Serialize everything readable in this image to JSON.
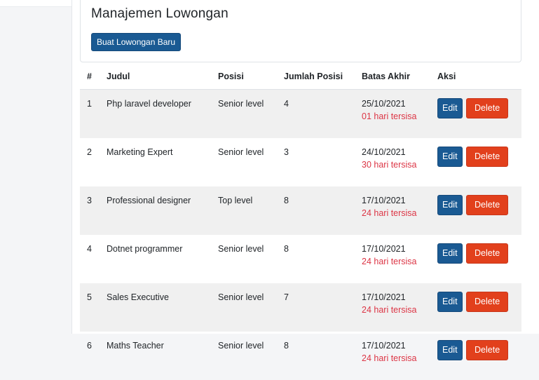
{
  "page": {
    "title": "Manajemen Lowongan",
    "create_button_label": "Buat Lowongan Baru"
  },
  "table": {
    "headers": {
      "num": "#",
      "judul": "Judul",
      "posisi": "Posisi",
      "jumlah": "Jumlah Posisi",
      "batas": "Batas Akhir",
      "aksi": "Aksi"
    },
    "rows": [
      {
        "num": "1",
        "judul": "Php laravel developer",
        "posisi": "Senior level",
        "jumlah": "4",
        "batas": "25/10/2021",
        "sisa": "01 hari tersisa"
      },
      {
        "num": "2",
        "judul": "Marketing Expert",
        "posisi": "Senior level",
        "jumlah": "3",
        "batas": "24/10/2021",
        "sisa": "30 hari tersisa"
      },
      {
        "num": "3",
        "judul": "Professional designer",
        "posisi": "Top level",
        "jumlah": "8",
        "batas": "17/10/2021",
        "sisa": "24 hari tersisa"
      },
      {
        "num": "4",
        "judul": "Dotnet programmer",
        "posisi": "Senior level",
        "jumlah": "8",
        "batas": "17/10/2021",
        "sisa": "24 hari tersisa"
      },
      {
        "num": "5",
        "judul": "Sales Executive",
        "posisi": "Senior level",
        "jumlah": "7",
        "batas": "17/10/2021",
        "sisa": "24 hari tersisa"
      },
      {
        "num": "6",
        "judul": "Maths Teacher",
        "posisi": "Senior level",
        "jumlah": "8",
        "batas": "17/10/2021",
        "sisa": "24 hari tersisa"
      }
    ],
    "edit_label": "Edit",
    "delete_label": "Delete"
  },
  "colors": {
    "primary": "#1a5a93",
    "danger": "#e2401c",
    "remaining_text": "#dc3545",
    "stripe": "#f0f0f0"
  }
}
